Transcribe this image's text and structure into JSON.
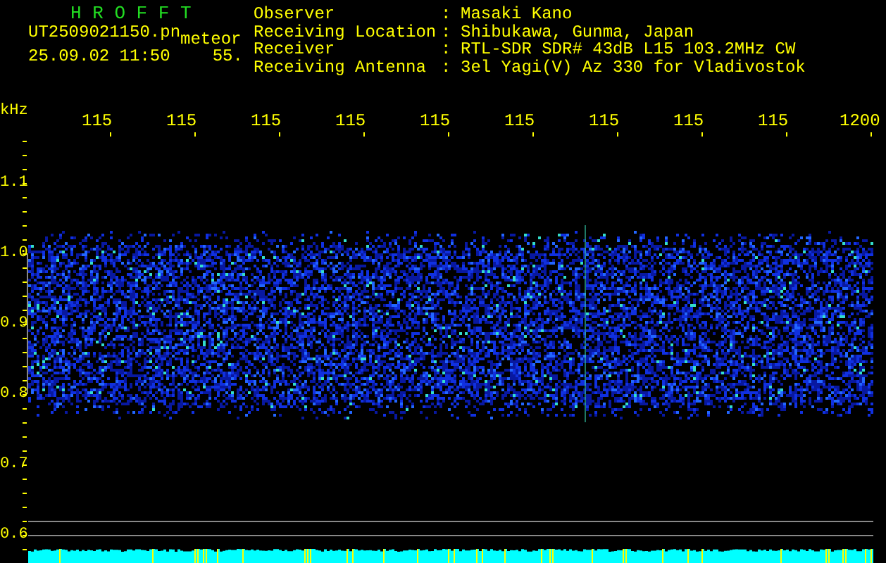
{
  "header": {
    "title": "H R O F F T",
    "file": "UT2509021150.pn",
    "tag": "meteor",
    "datetime": "25.09.02 11:50",
    "value": "55.",
    "info": [
      {
        "label": "Observer",
        "separator": ":",
        "value": "Masaki Kano"
      },
      {
        "label": "Receiving Location",
        "separator": ":",
        "value": "Shibukawa, Gunma, Japan"
      },
      {
        "label": "Receiver",
        "separator": ":",
        "value": "RTL-SDR SDR# 43dB L15 103.2MHz CW"
      },
      {
        "label": "Receiving Antenna",
        "separator": ":",
        "value": "3el Yagi(V) Az 330 for Vladivostok"
      }
    ]
  },
  "x_axis": {
    "labels": [
      "115",
      "115",
      "115",
      "115",
      "115",
      "115",
      "115",
      "115",
      "115",
      "1200"
    ]
  },
  "y_axis": {
    "unit": "kHz",
    "labels": [
      "1.1",
      "1.0",
      "0.9",
      "0.8",
      "0.7",
      "0.6"
    ]
  }
}
